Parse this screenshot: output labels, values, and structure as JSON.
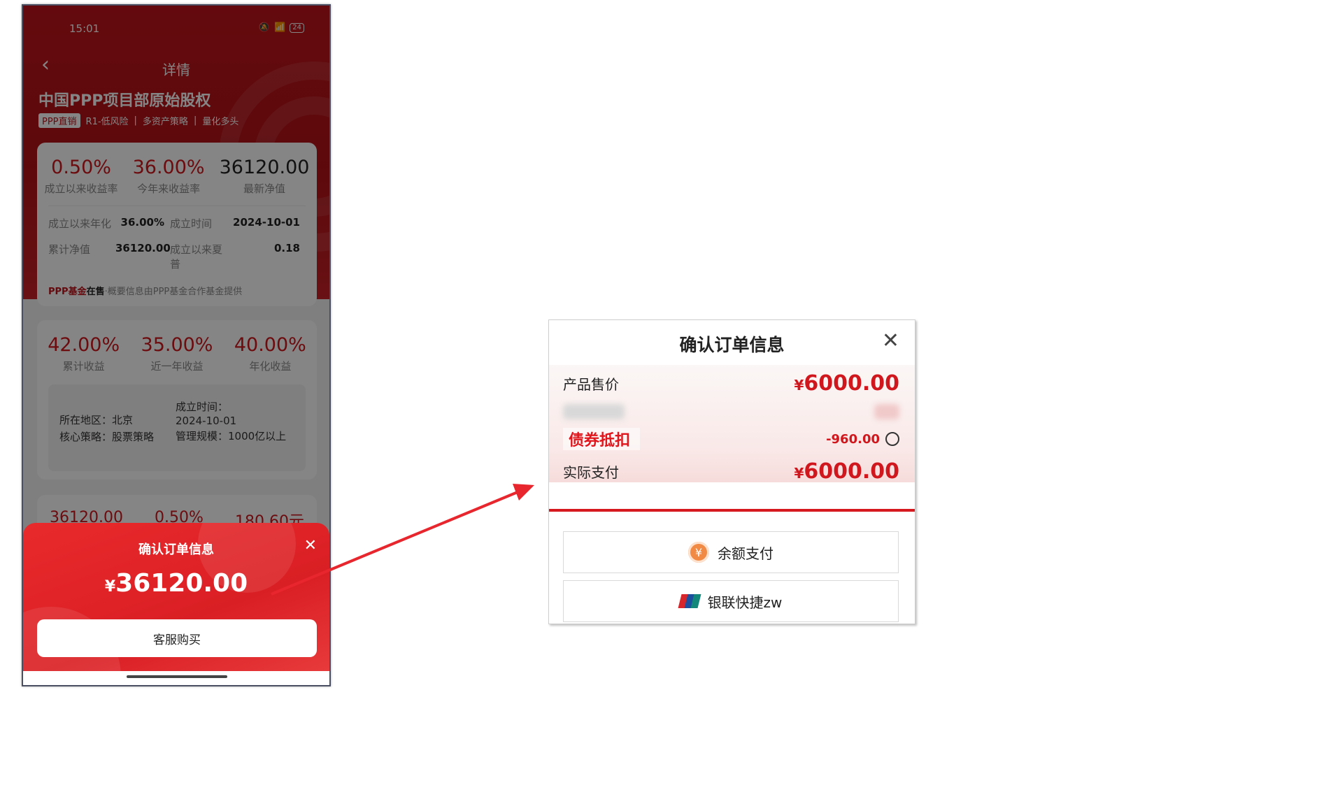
{
  "phone": {
    "status": {
      "time": "15:01",
      "battery": "24"
    },
    "nav_title": "详情",
    "product_title": "中国PPP项目部原始股权",
    "tags": [
      "PPP直销",
      "R1-低风险",
      "|",
      "多资产策略",
      "|",
      "量化多头"
    ],
    "stats1": [
      {
        "value": "0.50%",
        "label": "成立以来收益率"
      },
      {
        "value": "36.00%",
        "label": "今年来收益率"
      },
      {
        "value": "36120.00",
        "label": "最新净值"
      }
    ],
    "details": [
      {
        "k": "成立以来年化",
        "v": "36.00%"
      },
      {
        "k": "成立时间",
        "v": "2024-10-01"
      },
      {
        "k": "累计净值",
        "v": "36120.00"
      },
      {
        "k": "成立以来夏普",
        "v": "0.18"
      }
    ],
    "source": {
      "brand": "PPP基金",
      "status": "在售",
      "text": "·概要信息由PPP基金合作基金提供"
    },
    "stats2": [
      {
        "value": "42.00%",
        "label": "累计收益"
      },
      {
        "value": "35.00%",
        "label": "近一年收益"
      },
      {
        "value": "40.00%",
        "label": "年化收益"
      }
    ],
    "info": {
      "region": "所在地区：北京",
      "strategy": "核心策略：股票策略",
      "founded_label": "成立时间：",
      "founded_value": "2024-10-01",
      "scale": "管理规模：1000亿以上"
    },
    "stats3": [
      "36120.00",
      "0.50%",
      "180.60元"
    ],
    "sheet": {
      "title": "确认订单信息",
      "close": "✕",
      "currency": "¥",
      "amount": "36120.00",
      "button": "客服购买"
    }
  },
  "zoom": {
    "title": "确认订单信息",
    "close": "✕",
    "price_label": "产品售价",
    "price_currency": "¥",
    "price_value": "6000.00",
    "coupon_label": "债券抵扣",
    "discount": "-960.00",
    "actual_label": "实际支付",
    "actual_currency": "¥",
    "actual_value": "6000.00",
    "pay_balance": "余额支付",
    "pay_unionpay": "银联快捷zw"
  },
  "colors": {
    "brand_red": "#d0171e",
    "arrow_red": "#e8262d"
  }
}
